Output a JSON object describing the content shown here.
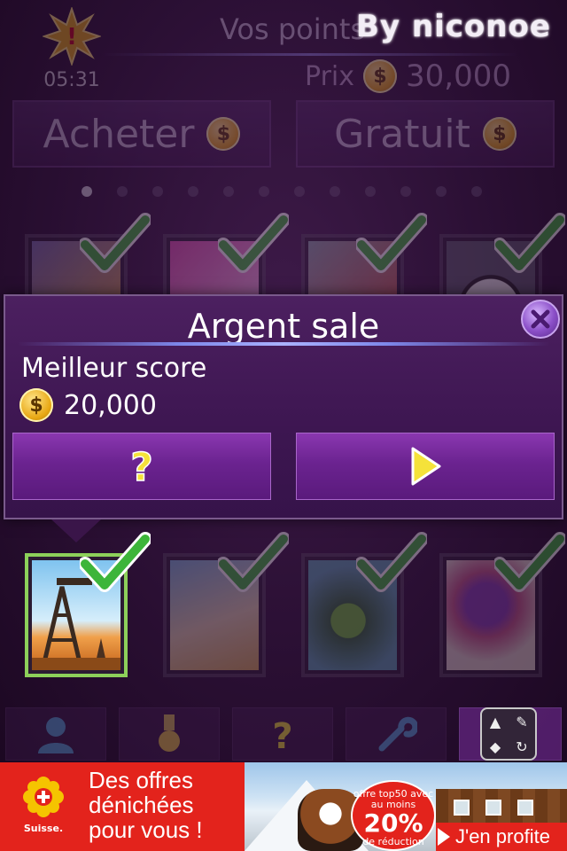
{
  "header": {
    "timer": "05:31",
    "points_label": "Vos points",
    "watermark": "By niconoe",
    "price_label": "Prix",
    "price_value": "30,000",
    "buy_label": "Acheter",
    "free_label": "Gratuit",
    "coin_symbol": "$"
  },
  "pagination": {
    "count": 12,
    "active_index": 0
  },
  "modal": {
    "title": "Argent sale",
    "best_score_label": "Meilleur score",
    "best_score_value": "20,000",
    "coin_symbol": "$",
    "help_symbol": "?",
    "close_icon": "close-x-icon",
    "play_icon": "play-triangle-icon"
  },
  "cards": {
    "top_row": [
      "card-1",
      "card-2",
      "card-3",
      "card-4"
    ],
    "bottom_row": [
      "argent-sale",
      "card-6",
      "card-7",
      "card-8"
    ],
    "selected": "argent-sale"
  },
  "toolbar": {
    "items": [
      "profile-icon",
      "medal-icon",
      "help-icon",
      "wrench-icon",
      "more-icon"
    ],
    "help_symbol": "?"
  },
  "ad": {
    "brand": "Suisse.",
    "line1": "Des offres",
    "line2": "dénichées",
    "line3": "pour vous !",
    "badge_top": "offre top50 avec au moins",
    "badge_pct": "20%",
    "badge_bottom": "de réduction",
    "cta": "J'en profite"
  },
  "colors": {
    "background": "#2a0f33",
    "modal": "#3d1651",
    "button_purple": "#6b2390",
    "coin_gold": "#e8a814",
    "check_green": "#3db53a",
    "ad_red": "#e3231c"
  }
}
